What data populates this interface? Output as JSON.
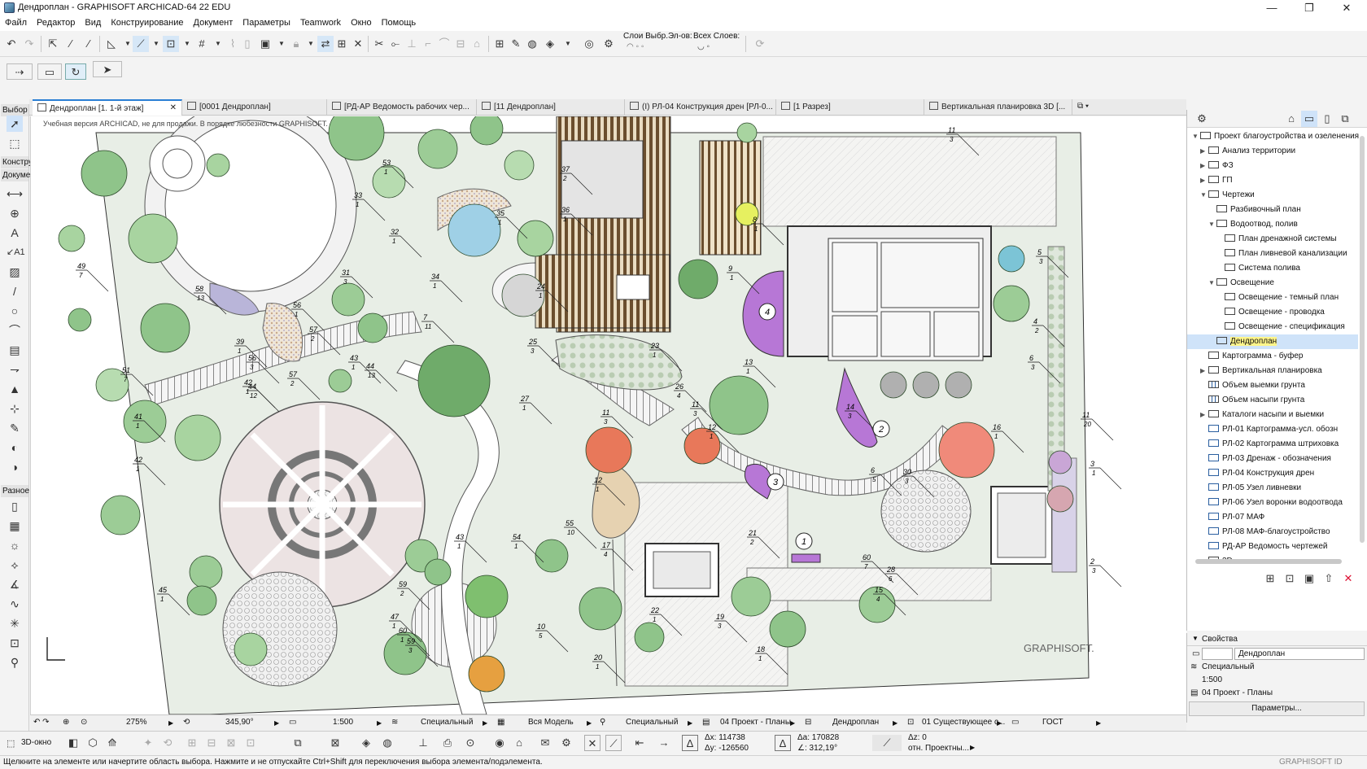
{
  "window": {
    "title": "Дендроплан - GRAPHISOFT ARCHICAD-64 22 EDU"
  },
  "menu": [
    "Файл",
    "Редактор",
    "Вид",
    "Конструирование",
    "Документ",
    "Параметры",
    "Teamwork",
    "Окно",
    "Помощь"
  ],
  "toolbar": {
    "layers_label": "Слои Выбр.Эл-ов:",
    "all_layers_label": "Всех Слоев:"
  },
  "toolbox": {
    "select_label": "Выбор",
    "construct_label": "Констру",
    "document_label": "Докуме",
    "misc_label": "Разное"
  },
  "tabs": [
    {
      "label": "Дендроплан [1. 1-й этаж]",
      "active": true
    },
    {
      "label": "[0001 Дендроплан]"
    },
    {
      "label": "[РД-АР Ведомость рабочих чер..."
    },
    {
      "label": "[11 Дендроплан]"
    },
    {
      "label": "(I) РЛ-04 Конструкция дрен [РЛ-0..."
    },
    {
      "label": "[1 Разрез]"
    },
    {
      "label": "Вертикальная планировка 3D [..."
    }
  ],
  "drawing": {
    "watermark": "Учебная версия ARCHICAD, не для продажи. В порядке любезности GRAPHISOFT.",
    "logo": "GRAPHISOFT.",
    "labels": [
      {
        "n": "53",
        "s": "1"
      },
      {
        "n": "33",
        "s": "1"
      },
      {
        "n": "37",
        "s": "2"
      },
      {
        "n": "36",
        "s": "1"
      },
      {
        "n": "35",
        "s": "1"
      },
      {
        "n": "32",
        "s": "1"
      },
      {
        "n": "49",
        "s": "7"
      },
      {
        "n": "31",
        "s": "3"
      },
      {
        "n": "34",
        "s": "1"
      },
      {
        "n": "58",
        "s": "13"
      },
      {
        "n": "56",
        "s": "1"
      },
      {
        "n": "57",
        "s": "2"
      },
      {
        "n": "39",
        "s": "1"
      },
      {
        "n": "56",
        "s": "3"
      },
      {
        "n": "57",
        "s": "2"
      },
      {
        "n": "24",
        "s": "1"
      },
      {
        "n": "7",
        "s": "11"
      },
      {
        "n": "8",
        "s": "1"
      },
      {
        "n": "9",
        "s": "1"
      },
      {
        "n": "5",
        "s": "3"
      },
      {
        "n": "4",
        "s": "2"
      },
      {
        "n": "6",
        "s": "3"
      },
      {
        "n": "11",
        "s": "20"
      },
      {
        "n": "51",
        "s": "7"
      },
      {
        "n": "43",
        "s": "1"
      },
      {
        "n": "44",
        "s": "13"
      },
      {
        "n": "25",
        "s": "3"
      },
      {
        "n": "23",
        "s": "1"
      },
      {
        "n": "26",
        "s": "4"
      },
      {
        "n": "27",
        "s": "1"
      },
      {
        "n": "13",
        "s": "1"
      },
      {
        "n": "14",
        "s": "3"
      },
      {
        "n": "42",
        "s": "1"
      },
      {
        "n": "44",
        "s": "12"
      },
      {
        "n": "41",
        "s": "1"
      },
      {
        "n": "11",
        "s": "3"
      },
      {
        "n": "11",
        "s": "3"
      },
      {
        "n": "12",
        "s": "1"
      },
      {
        "n": "16",
        "s": "1"
      },
      {
        "n": "42",
        "s": "1"
      },
      {
        "n": "12",
        "s": "1"
      },
      {
        "n": "6",
        "s": "5"
      },
      {
        "n": "30",
        "s": "3"
      },
      {
        "n": "3",
        "s": "1"
      },
      {
        "n": "55",
        "s": "10"
      },
      {
        "n": "17",
        "s": "4"
      },
      {
        "n": "43",
        "s": "1"
      },
      {
        "n": "54",
        "s": "1"
      },
      {
        "n": "21",
        "s": "2"
      },
      {
        "n": "60",
        "s": "7"
      },
      {
        "n": "28",
        "s": "6"
      },
      {
        "n": "2",
        "s": "3"
      },
      {
        "n": "45",
        "s": "1"
      },
      {
        "n": "59",
        "s": "2"
      },
      {
        "n": "22",
        "s": "1"
      },
      {
        "n": "15",
        "s": "4"
      },
      {
        "n": "47",
        "s": "1"
      },
      {
        "n": "60",
        "s": "1"
      },
      {
        "n": "59",
        "s": "3"
      },
      {
        "n": "10",
        "s": "5"
      },
      {
        "n": "19",
        "s": "3"
      },
      {
        "n": "20",
        "s": "1"
      },
      {
        "n": "18",
        "s": "1"
      },
      {
        "n": "11",
        "s": "3"
      }
    ],
    "markers": [
      "1",
      "2",
      "3",
      "4"
    ]
  },
  "navigator": {
    "items": [
      {
        "label": "Проект благоустройства и озеленения",
        "level": 0,
        "open": true
      },
      {
        "label": "Анализ территории",
        "level": 1,
        "twist": true
      },
      {
        "label": "ФЗ",
        "level": 1,
        "twist": true
      },
      {
        "label": "ГП",
        "level": 1,
        "twist": true
      },
      {
        "label": "Чертежи",
        "level": 1,
        "open": true
      },
      {
        "label": "Разбивочный план",
        "level": 2
      },
      {
        "label": "Водоотвод, полив",
        "level": 2,
        "open": true
      },
      {
        "label": "План дренажной системы",
        "level": 3
      },
      {
        "label": "План ливневой канализации",
        "level": 3
      },
      {
        "label": "Система полива",
        "level": 3
      },
      {
        "label": "Освещение",
        "level": 2,
        "open": true
      },
      {
        "label": "Освещение - темный план",
        "level": 3
      },
      {
        "label": "Освещение - проводка",
        "level": 3
      },
      {
        "label": "Освещение - спецификация",
        "level": 3
      },
      {
        "label": "Дендроплан",
        "level": 2,
        "selected": true
      },
      {
        "label": "Картограмма - буфер",
        "level": 1
      },
      {
        "label": "Вертикальная планировка",
        "level": 1,
        "twist": true
      },
      {
        "label": "Объем выемки грунта",
        "level": 1,
        "grid": true
      },
      {
        "label": "Объем насыпи грунта",
        "level": 1,
        "grid": true
      },
      {
        "label": "Каталоги насыпи и выемки",
        "level": 1,
        "twist": true
      },
      {
        "label": "РЛ-01 Картограмма-усл. обозн",
        "level": 1,
        "vp": true
      },
      {
        "label": "РЛ-02 Картограмма штриховка",
        "level": 1,
        "vp": true
      },
      {
        "label": "РЛ-03 Дренаж - обозначения",
        "level": 1,
        "vp": true
      },
      {
        "label": "РЛ-04 Конструкция дрен",
        "level": 1,
        "vp": true
      },
      {
        "label": "РЛ-05  Узел ливневки",
        "level": 1,
        "vp": true
      },
      {
        "label": "РЛ-06  Узел воронки водоотвода",
        "level": 1,
        "vp": true
      },
      {
        "label": "РЛ-07 МАФ",
        "level": 1,
        "vp": true
      },
      {
        "label": "РЛ-08 МАФ-благоустройство",
        "level": 1,
        "vp": true
      },
      {
        "label": "РД-АР Ведомость чертежей",
        "level": 1,
        "vp": true
      },
      {
        "label": "3D",
        "level": 1
      }
    ]
  },
  "properties": {
    "header": "Свойства",
    "name_value": "Дендроплан",
    "model_view": "Специальный",
    "scale": "1:500",
    "layer_set": "04 Проект - Планы",
    "button": "Параметры..."
  },
  "statusnav": {
    "zoom": "275%",
    "angle": "345,90°",
    "scale": "1:500",
    "pen": "Специальный",
    "model": "Вся Модель",
    "override": "Специальный",
    "layers": "04 Проект - Планы",
    "view": "Дендроплан",
    "renovation": "01 Существующее с...",
    "dim": "ГОСТ"
  },
  "coords": {
    "dx": "Δx: 114738",
    "dy": "Δy: -126560",
    "da": "Δa: 170828",
    "angle": "∠: 312,19°",
    "dz": "Δz: 0",
    "ref": "отн. Проектны..."
  },
  "bottom": {
    "view3d": "3D-окно"
  },
  "status": {
    "text": "Щелкните на элементе или начертите область выбора. Нажмите и не отпускайте Ctrl+Shift для переключения выбора элемента/подэлемента.",
    "brand": "GRAPHISOFT ID"
  }
}
